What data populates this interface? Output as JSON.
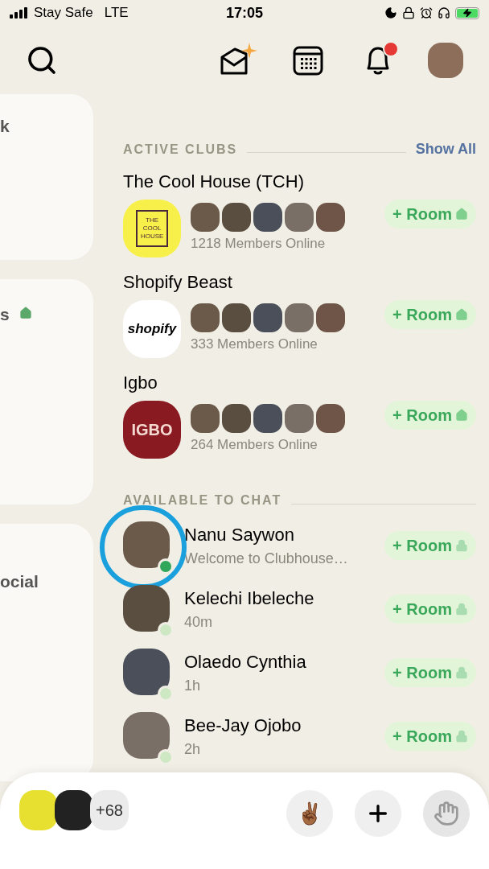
{
  "status_bar": {
    "carrier": "Stay Safe",
    "network": "LTE",
    "time": "17:05"
  },
  "top_bar": {
    "notifications_unread": true
  },
  "left_cards": [
    {
      "text": "k",
      "house": false
    },
    {
      "text": "s",
      "house": true
    },
    {
      "text": "ocial",
      "house": false
    }
  ],
  "active_clubs": {
    "heading": "ACTIVE CLUBS",
    "show_all": "Show All",
    "clubs": [
      {
        "name": "The Cool House (TCH)",
        "logo_text": "THE COOL HOUSE",
        "kind": "house",
        "members_online": "1218 Members Online",
        "room_button": "+ Room"
      },
      {
        "name": "Shopify Beast",
        "logo_text": "shopify",
        "kind": "shop",
        "members_online": "333 Members Online",
        "room_button": "+ Room"
      },
      {
        "name": "Igbo",
        "logo_text": "IGBO",
        "kind": "roses",
        "members_online": "264 Members Online",
        "room_button": "+ Room"
      }
    ]
  },
  "available_to_chat": {
    "heading": "AVAILABLE TO CHAT",
    "people": [
      {
        "name": "Nanu Saywon",
        "subtitle": "Welcome to Clubhouse…",
        "online": true,
        "highlighted": true,
        "room_button": "+ Room"
      },
      {
        "name": "Kelechi Ibeleche",
        "subtitle": "40m",
        "online": false,
        "highlighted": false,
        "room_button": "+ Room"
      },
      {
        "name": "Olaedo Cynthia",
        "subtitle": "1h",
        "online": false,
        "highlighted": false,
        "room_button": "+ Room"
      },
      {
        "name": "Bee-Jay Ojobo",
        "subtitle": "2h",
        "online": false,
        "highlighted": false,
        "room_button": "+ Room"
      }
    ]
  },
  "bottom_bar": {
    "more_count": "+68",
    "wave_emoji": "✌🏾"
  }
}
